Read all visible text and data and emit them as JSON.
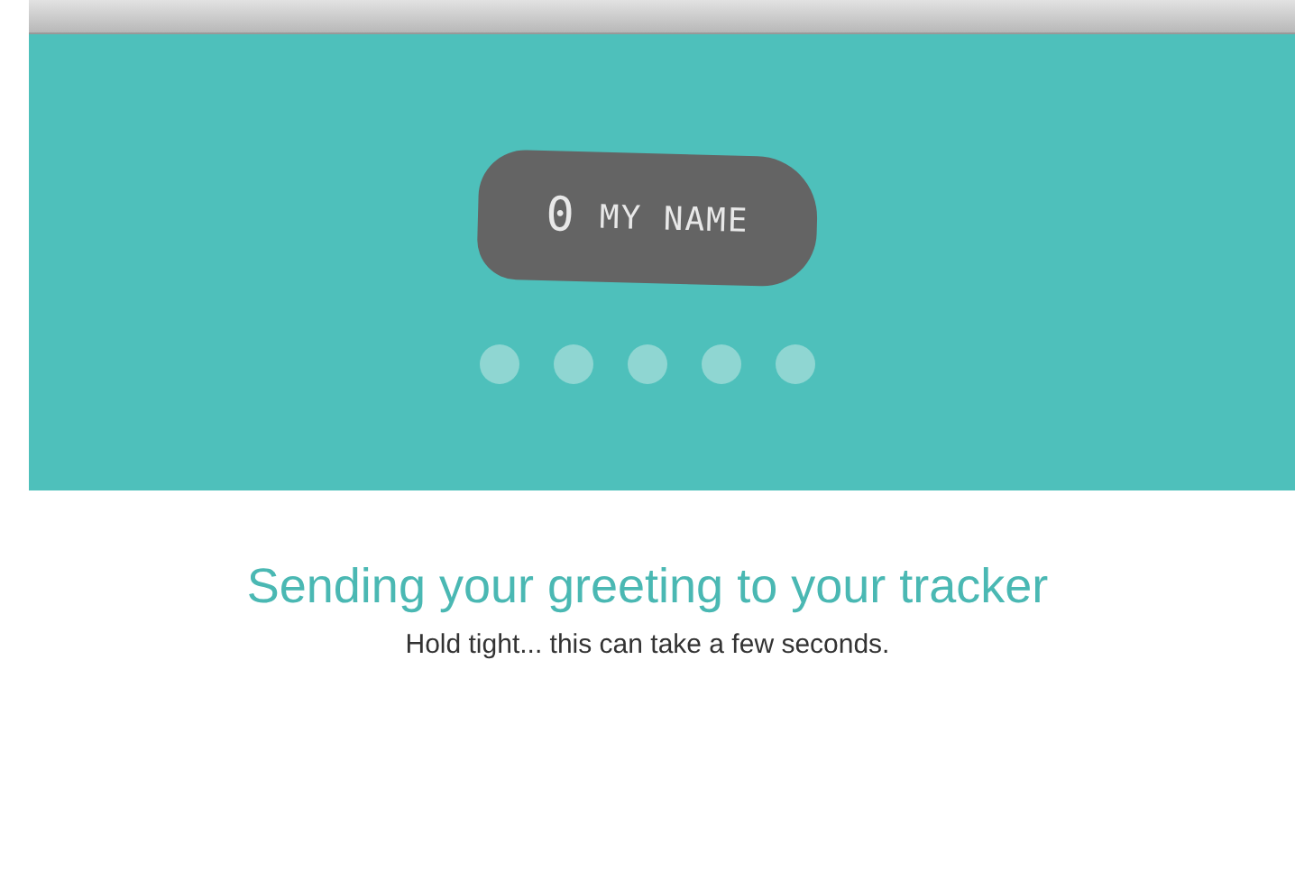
{
  "device_display": {
    "digit": "0",
    "text": "MY NAME"
  },
  "heading": "Sending your greeting to your tracker",
  "subtitle": "Hold tight... this can take a few seconds."
}
